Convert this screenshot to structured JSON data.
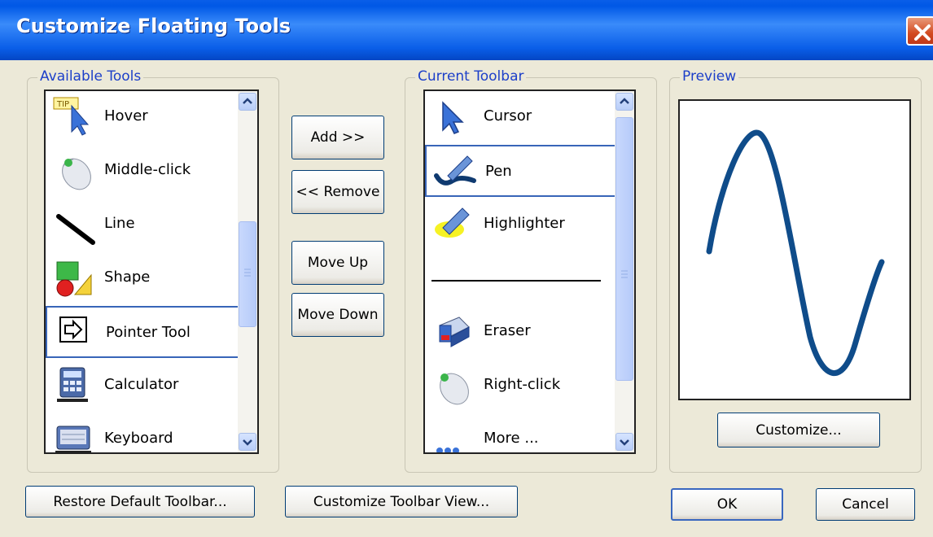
{
  "window": {
    "title": "Customize Floating Tools"
  },
  "available_tools": {
    "label": "Available Tools",
    "items": [
      {
        "label": "Hover",
        "icon": "hover-tip-cursor-icon"
      },
      {
        "label": "Middle-click",
        "icon": "mouse-middle-click-icon"
      },
      {
        "label": "Line",
        "icon": "line-icon"
      },
      {
        "label": "Shape",
        "icon": "shape-icon"
      },
      {
        "label": "Pointer Tool",
        "icon": "pointer-arrow-icon",
        "selected": true
      },
      {
        "label": "Calculator",
        "icon": "calculator-icon"
      },
      {
        "label": "Keyboard",
        "icon": "keyboard-icon"
      }
    ]
  },
  "actions": {
    "add": "Add >>",
    "remove": "<< Remove",
    "move_up": "Move Up",
    "move_down": "Move Down"
  },
  "current_toolbar": {
    "label": "Current Toolbar",
    "items": [
      {
        "label": "Cursor",
        "icon": "cursor-arrow-icon"
      },
      {
        "label": "Pen",
        "icon": "pen-icon",
        "selected": true
      },
      {
        "label": "Highlighter",
        "icon": "highlighter-icon"
      },
      {
        "label": "Eraser",
        "icon": "eraser-icon"
      },
      {
        "label": "Right-click",
        "icon": "mouse-right-click-icon"
      },
      {
        "label": "More ...",
        "icon": "more-dots-icon"
      }
    ]
  },
  "preview": {
    "label": "Preview",
    "customize": "Customize...",
    "stroke_color": "#0f4c8a"
  },
  "footer": {
    "restore": "Restore Default Toolbar...",
    "customize_view": "Customize Toolbar View...",
    "ok": "OK",
    "cancel": "Cancel"
  }
}
